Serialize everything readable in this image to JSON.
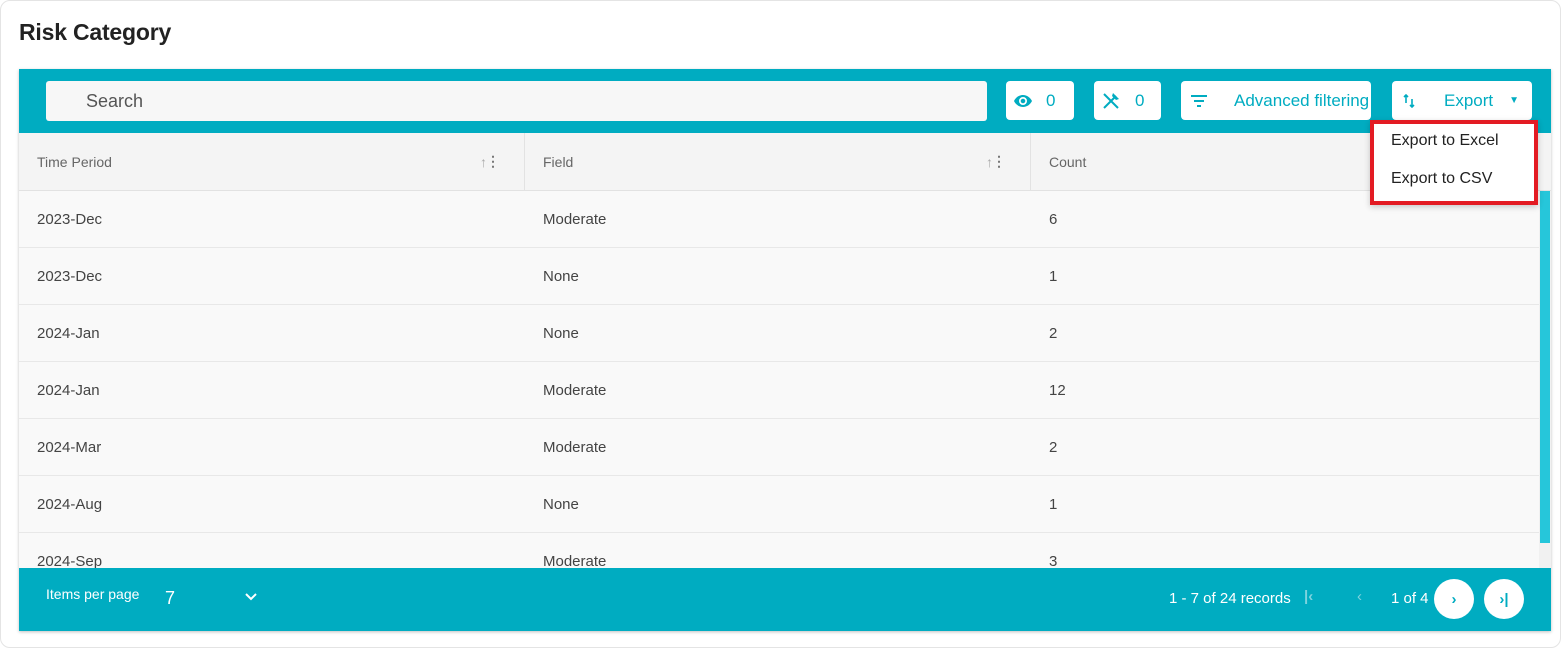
{
  "page": {
    "title": "Risk Category"
  },
  "toolbar": {
    "search_placeholder": "Search",
    "search_value": "",
    "visible_columns_count": "0",
    "pinned_columns_count": "0",
    "advanced_filtering_label": "Advanced filtering",
    "export_label": "Export"
  },
  "export_menu": {
    "items": [
      "Export to Excel",
      "Export to CSV"
    ]
  },
  "table": {
    "columns": [
      "Time Period",
      "Field",
      "Count"
    ],
    "rows": [
      [
        "2023-Dec",
        "Moderate",
        "6"
      ],
      [
        "2023-Dec",
        "None",
        "1"
      ],
      [
        "2024-Jan",
        "None",
        "2"
      ],
      [
        "2024-Jan",
        "Moderate",
        "12"
      ],
      [
        "2024-Mar",
        "Moderate",
        "2"
      ],
      [
        "2024-Aug",
        "None",
        "1"
      ],
      [
        "2024-Sep",
        "Moderate",
        "3"
      ]
    ]
  },
  "pagination": {
    "items_per_page_label": "Items per page",
    "items_per_page_value": "7",
    "records_text": "1 - 7 of 24 records",
    "page_info": "1 of 4"
  },
  "colors": {
    "accent": "#00acc1",
    "scrollbar": "#26c6da",
    "highlight_border": "#e31b23"
  },
  "icons": {
    "visible": "eye-icon",
    "pinned": "pin-off-icon",
    "filter": "filter-lines-icon",
    "export": "sort-arrows-icon",
    "caret": "caret-down-icon",
    "sort": "arrow-up-icon",
    "column_menu": "kebab-menu-icon"
  }
}
